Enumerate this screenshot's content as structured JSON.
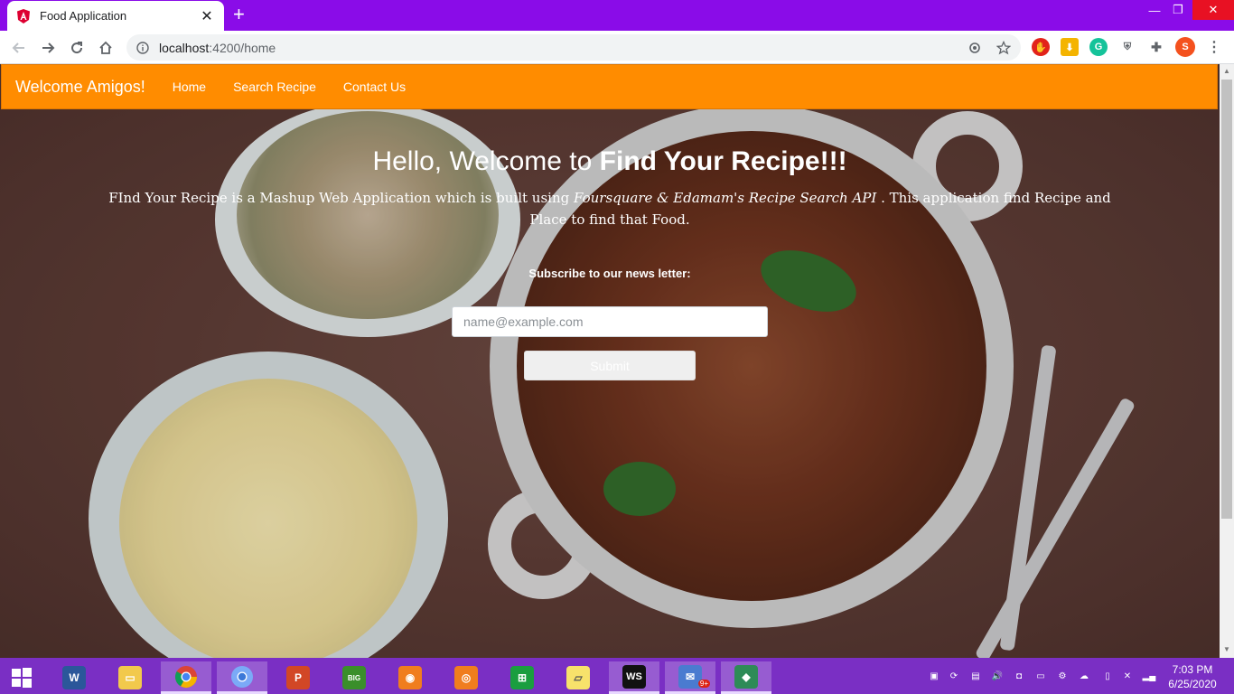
{
  "browser": {
    "tab_title": "Food Application",
    "url_host": "localhost",
    "url_path": ":4200/home",
    "profile_initial": "S"
  },
  "navbar": {
    "brand": "Welcome Amigos!",
    "links": [
      "Home",
      "Search Recipe",
      "Contact Us"
    ]
  },
  "hero": {
    "title_prefix": "Hello, Welcome to ",
    "title_emphasis": "Find Your Recipe!!!",
    "desc_part1": "FInd Your Recipe is a Mashup Web Application which is built using ",
    "desc_italic": "Foursquare & Edamam's Recipe Search API",
    "desc_part2": " . This application find Recipe and Place to find that Food."
  },
  "subscribe": {
    "label": "Subscribe to our news letter:",
    "email_placeholder": "name@example.com",
    "submit_label": "Submit"
  },
  "taskbar": {
    "time": "7:03 PM",
    "date": "6/25/2020",
    "notification_badge": "9+"
  },
  "colors": {
    "navbar": "#ff8c00",
    "tabstrip": "#8a0ce8",
    "taskbar": "#7a2fc4"
  }
}
